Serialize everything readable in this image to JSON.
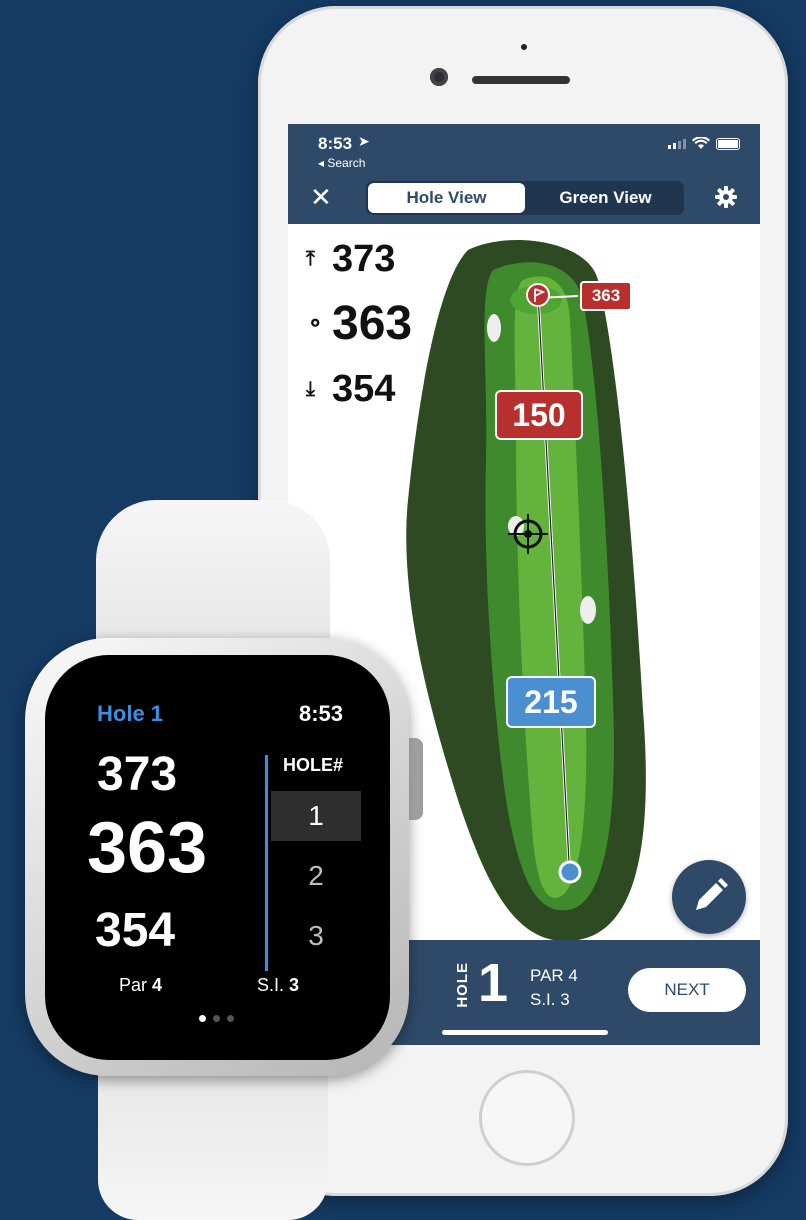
{
  "phone": {
    "status": {
      "time": "8:53",
      "back_label": "◂ Search"
    },
    "nav": {
      "close_icon": "close-icon",
      "tabs": [
        {
          "label": "Hole View",
          "active": true
        },
        {
          "label": "Green View",
          "active": false
        }
      ],
      "settings_icon": "gear-icon"
    },
    "distances": {
      "back": "373",
      "middle": "363",
      "front": "354"
    },
    "map": {
      "pin_distance": "363",
      "layup_distance": "150",
      "tee_distance": "215"
    },
    "bottom": {
      "hole_label": "HOLE",
      "hole_number": "1",
      "par": "PAR 4",
      "si": "S.I. 3",
      "next_label": "NEXT"
    }
  },
  "watch": {
    "title": "Hole 1",
    "time": "8:53",
    "distances": {
      "back": "373",
      "middle": "363",
      "front": "354"
    },
    "par_label": "Par",
    "par_value": "4",
    "si_label": "S.I.",
    "si_value": "3",
    "hole_header": "HOLE#",
    "holes": [
      "1",
      "2",
      "3"
    ],
    "selected_hole": "1"
  },
  "colors": {
    "background": "#153a63",
    "nav": "#2f4a68",
    "accent_blue": "#3a8fe0",
    "marker_red": "#b8302e",
    "marker_blue": "#4a8fd0"
  }
}
